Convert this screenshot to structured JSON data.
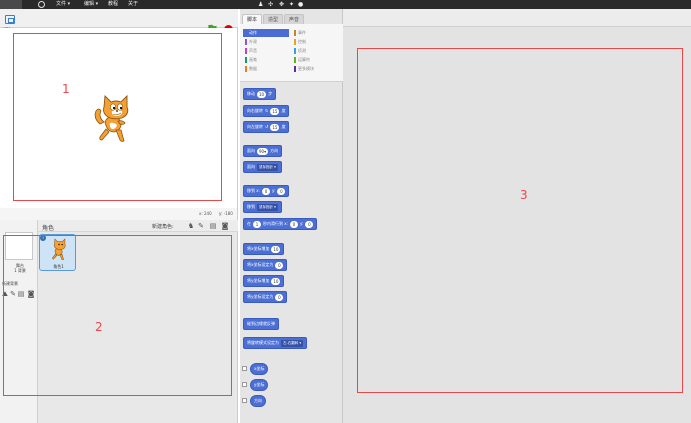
{
  "topbar": {
    "menus": [
      "文件 ▾",
      "编辑 ▾",
      "教程",
      "关于"
    ]
  },
  "stage": {
    "version": "v461"
  },
  "stage_coords": {
    "x_label": "x: 240",
    "y_label": "y: -180"
  },
  "sprite_pane": {
    "sprites_label": "角色",
    "new_sprite_label": "新建角色:",
    "stage_label": "舞台",
    "stage_backdrops": "1 背景",
    "new_backdrop_label": "新建背景",
    "sprite_name": "角色1",
    "sprite_info": "i"
  },
  "palette": {
    "tabs": [
      "脚本",
      "造型",
      "声音"
    ],
    "categories": [
      {
        "label": "动作",
        "color": "#4a6cd4"
      },
      {
        "label": "外观",
        "color": "#8a55d7"
      },
      {
        "label": "声音",
        "color": "#bb42c3"
      },
      {
        "label": "画笔",
        "color": "#0e9a6c"
      },
      {
        "label": "数据",
        "color": "#ee7d16"
      },
      {
        "label": "事件",
        "color": "#c88330"
      },
      {
        "label": "控制",
        "color": "#e1a91a"
      },
      {
        "label": "侦测",
        "color": "#2ca5e2"
      },
      {
        "label": "运算符",
        "color": "#5cb712"
      },
      {
        "label": "更多模块",
        "color": "#632d99"
      }
    ],
    "blocks": {
      "move_pre": "移动",
      "move_val": "10",
      "move_post": "步",
      "turn_right_pre": "向右旋转",
      "turn_right_val": "15",
      "turn_right_post": "度",
      "turn_left_pre": "向左旋转",
      "turn_left_val": "15",
      "turn_left_post": "度",
      "point_dir_pre": "面向",
      "point_dir_val": "90▾",
      "point_dir_post": "方向",
      "point_towards_pre": "面向",
      "point_towards_dd": "鼠标指针 ▾",
      "goto_xy_pre": "移到 x:",
      "goto_xy_x": "0",
      "goto_xy_mid": "y:",
      "goto_xy_y": "0",
      "goto_pre": "移到",
      "goto_dd": "鼠标指针 ▾",
      "glide_pre": "在",
      "glide_secs": "1",
      "glide_mid": "秒内滑行到 x:",
      "glide_x": "0",
      "glide_ymid": "y:",
      "glide_y": "0",
      "change_x_pre": "将x坐标增加",
      "change_x_val": "10",
      "set_x_pre": "将x坐标设定为",
      "set_x_val": "0",
      "change_y_pre": "将y坐标增加",
      "change_y_val": "10",
      "set_y_pre": "将y坐标设定为",
      "set_y_val": "0",
      "bounce": "碰到边缘就反弹",
      "rotation_style_pre": "将旋转模式设定为",
      "rotation_style_dd": "左-右翻转 ▾",
      "x_pos": "x坐标",
      "y_pos": "y坐标",
      "direction": "方向"
    }
  },
  "annotations": {
    "box1_label": "1",
    "box2_label": "2",
    "box3_label": "3",
    "box_color": "#e8484b"
  }
}
